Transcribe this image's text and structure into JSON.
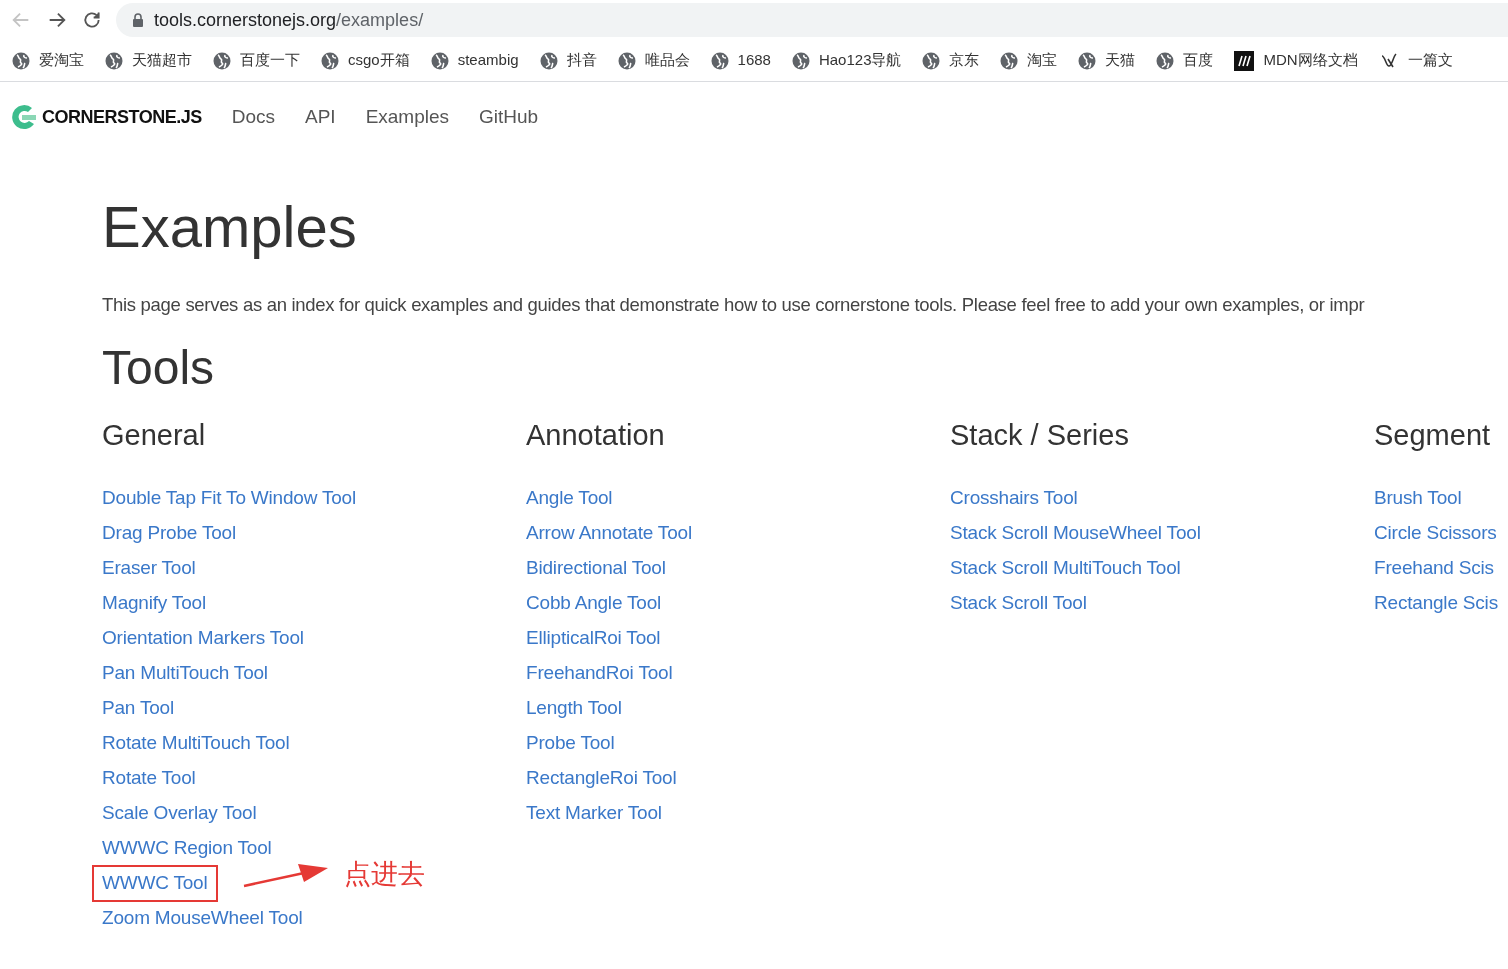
{
  "browser": {
    "back_disabled": true,
    "url_host": "tools.cornerstonejs.org",
    "url_path": "/examples/"
  },
  "bookmarks": [
    {
      "label": "爱淘宝",
      "kind": "globe"
    },
    {
      "label": "天猫超市",
      "kind": "globe"
    },
    {
      "label": "百度一下",
      "kind": "globe"
    },
    {
      "label": "csgo开箱",
      "kind": "globe"
    },
    {
      "label": "steambig",
      "kind": "globe"
    },
    {
      "label": "抖音",
      "kind": "globe"
    },
    {
      "label": "唯品会",
      "kind": "globe"
    },
    {
      "label": "1688",
      "kind": "globe"
    },
    {
      "label": "Hao123导航",
      "kind": "globe"
    },
    {
      "label": "京东",
      "kind": "globe"
    },
    {
      "label": "淘宝",
      "kind": "globe"
    },
    {
      "label": "天猫",
      "kind": "globe"
    },
    {
      "label": "百度",
      "kind": "globe"
    },
    {
      "label": "MDN网络文档",
      "kind": "mdn"
    },
    {
      "label": "一篇文",
      "kind": "custom"
    }
  ],
  "site": {
    "brand": "CORNERSTONE.JS",
    "nav": [
      "Docs",
      "API",
      "Examples",
      "GitHub"
    ]
  },
  "page": {
    "title": "Examples",
    "intro": "This page serves as an index for quick examples and guides that demonstrate how to use cornerstone tools. Please feel free to add your own examples, or impr",
    "section": "Tools"
  },
  "columns": [
    {
      "heading": "General",
      "items": [
        {
          "label": "Double Tap Fit To Window Tool",
          "highlighted": false
        },
        {
          "label": "Drag Probe Tool",
          "highlighted": false
        },
        {
          "label": "Eraser Tool",
          "highlighted": false
        },
        {
          "label": "Magnify Tool",
          "highlighted": false
        },
        {
          "label": "Orientation Markers Tool",
          "highlighted": false
        },
        {
          "label": "Pan MultiTouch Tool",
          "highlighted": false
        },
        {
          "label": "Pan Tool",
          "highlighted": false
        },
        {
          "label": "Rotate MultiTouch Tool",
          "highlighted": false
        },
        {
          "label": "Rotate Tool",
          "highlighted": false
        },
        {
          "label": "Scale Overlay Tool",
          "highlighted": false
        },
        {
          "label": "WWWC Region Tool",
          "highlighted": false
        },
        {
          "label": "WWWC Tool",
          "highlighted": true
        },
        {
          "label": "Zoom MouseWheel Tool",
          "highlighted": false
        }
      ]
    },
    {
      "heading": "Annotation",
      "items": [
        {
          "label": "Angle Tool",
          "highlighted": false
        },
        {
          "label": "Arrow Annotate Tool",
          "highlighted": false
        },
        {
          "label": "Bidirectional Tool",
          "highlighted": false
        },
        {
          "label": "Cobb Angle Tool",
          "highlighted": false
        },
        {
          "label": "EllipticalRoi Tool",
          "highlighted": false
        },
        {
          "label": "FreehandRoi Tool",
          "highlighted": false
        },
        {
          "label": "Length Tool",
          "highlighted": false
        },
        {
          "label": "Probe Tool",
          "highlighted": false
        },
        {
          "label": "RectangleRoi Tool",
          "highlighted": false
        },
        {
          "label": "Text Marker Tool",
          "highlighted": false
        }
      ]
    },
    {
      "heading": "Stack / Series",
      "items": [
        {
          "label": "Crosshairs Tool",
          "highlighted": false
        },
        {
          "label": "Stack Scroll MouseWheel Tool",
          "highlighted": false
        },
        {
          "label": "Stack Scroll MultiTouch Tool",
          "highlighted": false
        },
        {
          "label": "Stack Scroll Tool",
          "highlighted": false
        }
      ]
    },
    {
      "heading": "Segment",
      "items": [
        {
          "label": "Brush Tool",
          "highlighted": false
        },
        {
          "label": "Circle Scissors",
          "highlighted": false
        },
        {
          "label": "Freehand Scis",
          "highlighted": false
        },
        {
          "label": "Rectangle Scis",
          "highlighted": false
        }
      ]
    }
  ],
  "annotation": {
    "note": "点进去"
  }
}
